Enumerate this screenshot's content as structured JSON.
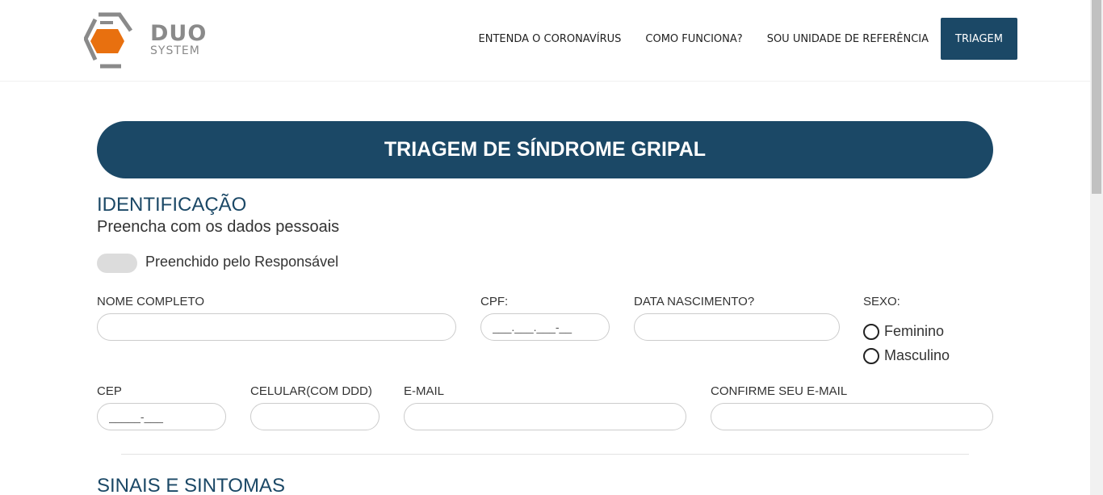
{
  "header": {
    "logo": {
      "name": "DUO",
      "sub": "SYSTEM"
    },
    "nav": [
      {
        "label": "ENTENDA O CORONAVÍRUS"
      },
      {
        "label": "COMO FUNCIONA?"
      },
      {
        "label": "SOU UNIDADE DE REFERÊNCIA"
      }
    ],
    "cta_label": "TRIAGEM"
  },
  "banner": {
    "title": "TRIAGEM DE SÍNDROME GRIPAL"
  },
  "identification": {
    "title": "IDENTIFICAÇÃO",
    "subtitle": "Preencha com os dados pessoais",
    "toggle_label": "Preenchido pelo Responsável"
  },
  "fields": {
    "name": {
      "label": "NOME COMPLETO",
      "value": "",
      "placeholder": ""
    },
    "cpf": {
      "label": "CPF:",
      "value": "",
      "placeholder": "___.___.___-__"
    },
    "birth": {
      "label": "DATA NASCIMENTO?",
      "value": "",
      "placeholder": ""
    },
    "sex": {
      "label": "SEXO:",
      "options": [
        "Feminino",
        "Masculino"
      ]
    },
    "cep": {
      "label": "CEP",
      "value": "",
      "placeholder": "_____-___"
    },
    "phone": {
      "label": "CELULAR(COM DDD)",
      "value": "",
      "placeholder": ""
    },
    "email": {
      "label": "E-MAIL",
      "value": "",
      "placeholder": ""
    },
    "email_confirm": {
      "label": "CONFIRME SEU E-MAIL",
      "value": "",
      "placeholder": ""
    }
  },
  "symptoms": {
    "title": "SINAIS E SINTOMAS"
  },
  "colors": {
    "primary": "#1b4866",
    "logo_orange": "#e8700f",
    "logo_gray": "#8a8a8a"
  }
}
